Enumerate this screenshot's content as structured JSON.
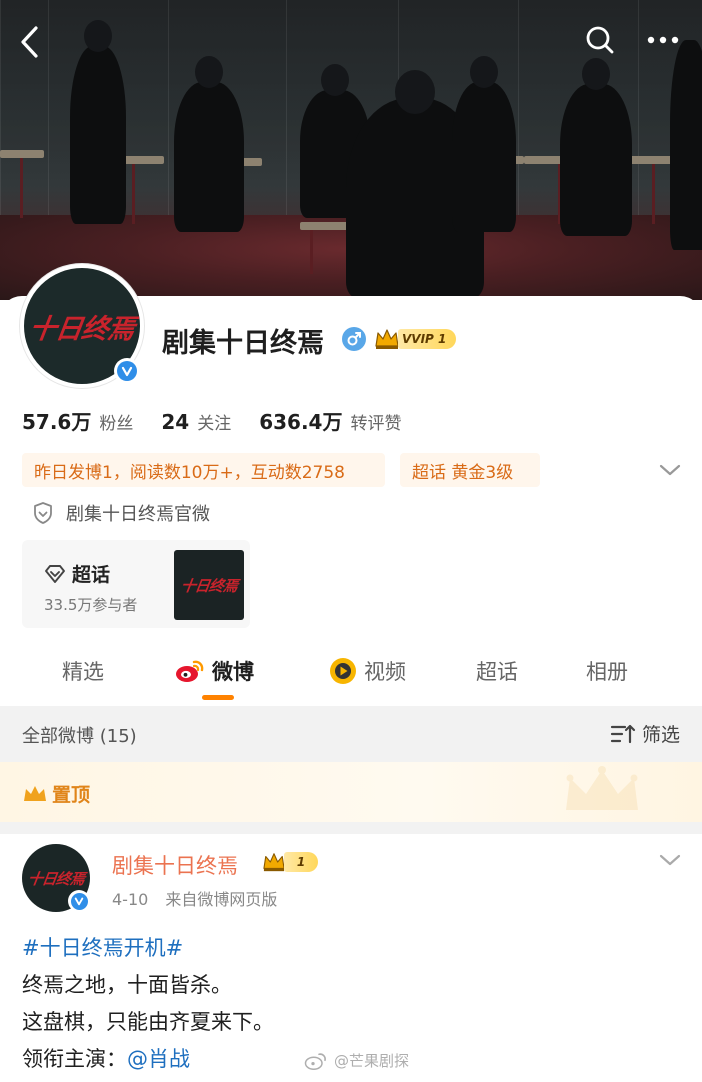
{
  "header": {
    "back_icon": "chevron-left-icon",
    "search_icon": "search-icon",
    "more_icon": "more-horizontal-icon"
  },
  "profile": {
    "avatar_logo": "十日终焉",
    "name": "剧集十日终焉",
    "gender": "male",
    "vip_label": "VVIP 1",
    "stats": [
      {
        "num": "57.6万",
        "label": "粉丝"
      },
      {
        "num": "24",
        "label": "关注"
      },
      {
        "num": "636.4万",
        "label": "转评赞"
      }
    ],
    "activity_pill": "昨日发博1，阅读数10万+，互动数2758",
    "supertopic_pill": "超话 黄金3级",
    "official_label": "剧集十日终焉官微"
  },
  "supertopic": {
    "title": "超话",
    "participants": "33.5万参与者",
    "thumb_logo": "十日终焉"
  },
  "tabs": [
    {
      "label": "精选",
      "icon": ""
    },
    {
      "label": "微博",
      "icon": "weibo-icon"
    },
    {
      "label": "视频",
      "icon": "video-icon"
    },
    {
      "label": "超话",
      "icon": ""
    },
    {
      "label": "相册",
      "icon": ""
    }
  ],
  "feed": {
    "count_label": "全部微博 (15)",
    "filter_label": "筛选",
    "pinned_label": "置顶"
  },
  "post": {
    "author": "剧集十日终焉",
    "rank_label": "1",
    "date": "4-10",
    "source": "来自微博网页版",
    "topic": "#十日终焉开机#",
    "line1": "终焉之地，十面皆杀。",
    "line2": "这盘棋，只能由齐夏来下。",
    "lead_prefix": "领衔主演：",
    "lead_mention": "@肖战",
    "avatar_logo": "十日终焉"
  },
  "watermark": "@芒果剧探",
  "colors": {
    "accent": "#ff8200",
    "link": "#1e6fbf",
    "author": "#eb7350",
    "pill_text": "#d96b17"
  }
}
